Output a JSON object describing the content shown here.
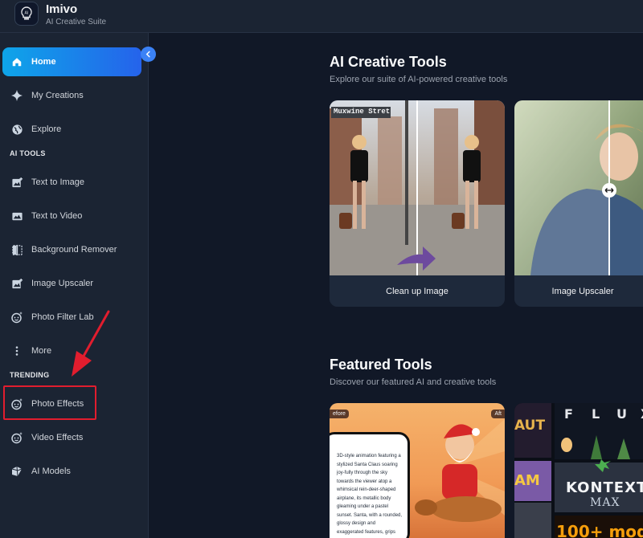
{
  "app": {
    "name": "Imivo",
    "tagline": "AI Creative Suite"
  },
  "sidebar": {
    "main_items": [
      {
        "label": "Home",
        "icon": "home-icon",
        "active": true
      },
      {
        "label": "My Creations",
        "icon": "sparkle-icon"
      },
      {
        "label": "Explore",
        "icon": "globe-icon"
      }
    ],
    "ai_tools_label": "AI TOOLS",
    "ai_tools": [
      {
        "label": "Text to Image",
        "icon": "image-plus-icon"
      },
      {
        "label": "Text to Video",
        "icon": "video-icon"
      },
      {
        "label": "Background Remover",
        "icon": "split-frame-icon"
      },
      {
        "label": "Image Upscaler",
        "icon": "image-plus-icon"
      },
      {
        "label": "Photo Filter Lab",
        "icon": "face-sparkle-icon"
      },
      {
        "label": "More",
        "icon": "more-vertical-icon"
      }
    ],
    "trending_label": "TRENDING",
    "trending": [
      {
        "label": "Photo Effects",
        "icon": "face-sparkle-icon"
      },
      {
        "label": "Video Effects",
        "icon": "face-sparkle-icon"
      },
      {
        "label": "AI Models",
        "icon": "cube-icon"
      }
    ]
  },
  "main": {
    "creative_tools": {
      "title": "AI Creative Tools",
      "subtitle": "Explore our suite of AI-powered creative tools",
      "cards": [
        {
          "label": "Clean up Image",
          "sign_text": "Muxwine Stret"
        },
        {
          "label": "Image Upscaler"
        }
      ]
    },
    "featured_tools": {
      "title": "Featured Tools",
      "subtitle": "Discover our featured AI and creative tools",
      "card1": {
        "before_badge": "efore",
        "after_badge": "Aft",
        "prompt_text": "3D-style animation featuring a stylized Santa Claus soaring joy-fully through the sky towards the viewer atop a whimsical rein-deer-shaped airplane, its metallic body gleaming under a pastel sunset. Santa, with a rounded, glossy design and exaggerated features, grips the handlebars as his red coat flutters in the wind."
      },
      "card2": {
        "flux_letters": [
          "F",
          "L",
          "U",
          "X"
        ],
        "aut_text": "AUT",
        "am_text": "AM",
        "kontext_text": "KONTEXT",
        "max_text": "MAX",
        "models_text": "100+ mod"
      }
    }
  }
}
